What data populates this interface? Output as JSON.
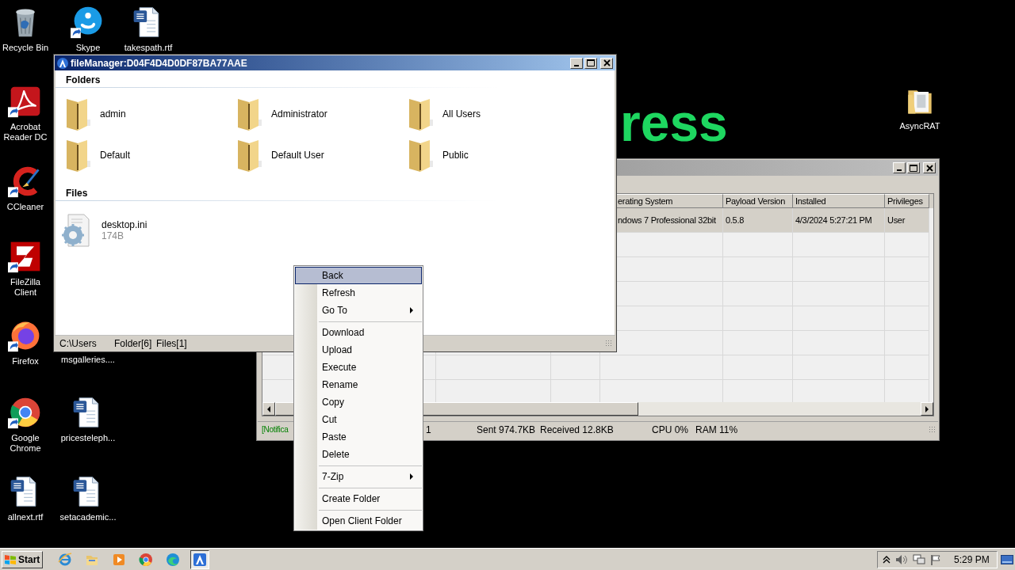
{
  "desktop_icons": [
    {
      "label": "Recycle Bin",
      "kind": "recycle",
      "shortcut": false
    },
    {
      "label": "Acrobat Reader DC",
      "kind": "acrobat",
      "shortcut": true
    },
    {
      "label": "CCleaner",
      "kind": "ccleaner",
      "shortcut": true
    },
    {
      "label": "FileZilla Client",
      "kind": "filezilla",
      "shortcut": true
    },
    {
      "label": "Firefox",
      "kind": "firefox",
      "shortcut": true
    },
    {
      "label": "Google Chrome",
      "kind": "chrome",
      "shortcut": true
    },
    {
      "label": "allnext.rtf",
      "kind": "document",
      "shortcut": false
    },
    {
      "label": "Skype",
      "kind": "skype",
      "shortcut": true
    },
    {
      "label": "msgalleries...."
    },
    {
      "label": "pricesteleph...",
      "kind": "document",
      "shortcut": false
    },
    {
      "label": "setacademic...",
      "kind": "document",
      "shortcut": false
    },
    {
      "label": "takespath.rtf",
      "kind": "document",
      "shortcut": false
    },
    {
      "label": "AsyncRAT",
      "kind": "folder",
      "shortcut": false
    }
  ],
  "wallpaper_text": "ress",
  "main_window": {
    "columns": [
      {
        "label": "erating System"
      },
      {
        "label": "Payload Version"
      },
      {
        "label": "Installed"
      },
      {
        "label": "Privileges"
      }
    ],
    "rows": [
      {
        "cells": [
          "ndows 7 Professional  32bit",
          "0.5.8",
          "4/3/2024 5:27:21 PM",
          "User"
        ],
        "selected": true
      }
    ],
    "status_bar": [
      {
        "text": "[Notifica",
        "kind": "notification"
      },
      {
        "text": "1",
        "kind": "plain"
      },
      {
        "text": "Sent 974.7KB",
        "kind": "plain"
      },
      {
        "text": "Received 12.8KB",
        "kind": "plain"
      },
      {
        "text": "CPU 0%",
        "kind": "plain"
      },
      {
        "text": "RAM 11%",
        "kind": "plain"
      }
    ]
  },
  "file_manager": {
    "title": "fileManager:D04F4D4D0DF87BA77AAE",
    "folders_header": "Folders",
    "folders": [
      {
        "name": "admin"
      },
      {
        "name": "Administrator"
      },
      {
        "name": "All Users"
      },
      {
        "name": "Default"
      },
      {
        "name": "Default User"
      },
      {
        "name": "Public"
      }
    ],
    "files_header": "Files",
    "files": [
      {
        "name": "desktop.ini",
        "size": "174B"
      }
    ],
    "status_bar": [
      "C:\\Users",
      "Folder[6]",
      "Files[1]"
    ]
  },
  "context_menu": {
    "groups": [
      [
        {
          "label": "Back",
          "selected": true,
          "submenu": false
        },
        {
          "label": "Refresh",
          "selected": false,
          "submenu": false
        },
        {
          "label": "Go To",
          "selected": false,
          "submenu": true
        }
      ],
      [
        {
          "label": "Download",
          "selected": false,
          "submenu": false
        },
        {
          "label": "Upload",
          "selected": false,
          "submenu": false
        },
        {
          "label": "Execute",
          "selected": false,
          "submenu": false
        },
        {
          "label": "Rename",
          "selected": false,
          "submenu": false
        },
        {
          "label": "Copy",
          "selected": false,
          "submenu": false
        },
        {
          "label": "Cut",
          "selected": false,
          "submenu": false
        },
        {
          "label": "Paste",
          "selected": false,
          "submenu": false
        },
        {
          "label": "Delete",
          "selected": false,
          "submenu": false
        }
      ],
      [
        {
          "label": "7-Zip",
          "selected": false,
          "submenu": true
        }
      ],
      [
        {
          "label": "Create Folder",
          "selected": false,
          "submenu": false
        }
      ],
      [
        {
          "label": "Open Client Folder",
          "selected": false,
          "submenu": false
        }
      ]
    ]
  },
  "taskbar": {
    "start": "Start",
    "apps": [
      {
        "kind": "ie",
        "active": false
      },
      {
        "kind": "explorer",
        "active": false
      },
      {
        "kind": "media",
        "active": false
      },
      {
        "kind": "chrome",
        "active": false
      },
      {
        "kind": "edge",
        "active": false
      },
      {
        "kind": "asyncrat",
        "active": true
      }
    ],
    "clock": "5:29 PM"
  }
}
